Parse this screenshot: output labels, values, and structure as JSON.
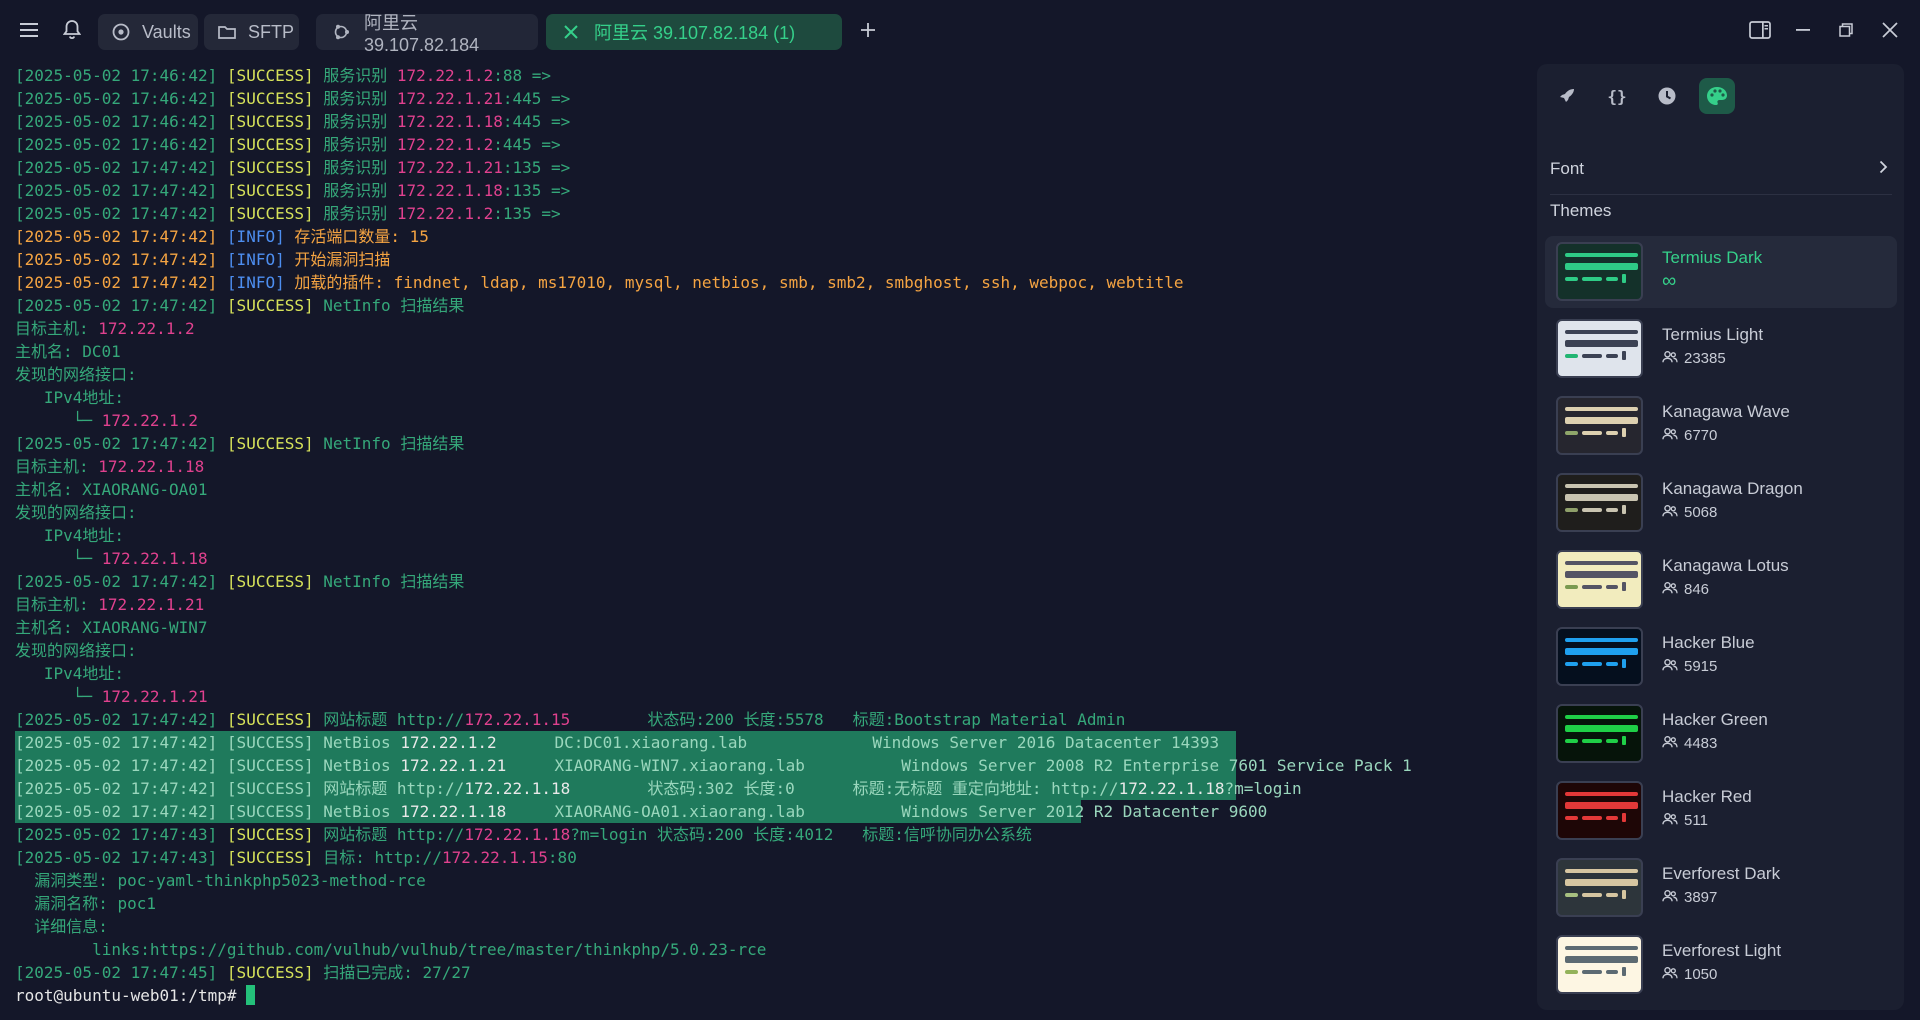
{
  "topbar": {
    "vaults_label": "Vaults",
    "sftp_label": "SFTP",
    "tabs": [
      {
        "label": "阿里云 39.107.82.184",
        "active": false
      },
      {
        "label": "阿里云 39.107.82.184 (1)",
        "active": true
      }
    ]
  },
  "terminal": {
    "lines": [
      {
        "segs": [
          {
            "c": "ts",
            "t": "[2025-05-02 17:46:42] "
          },
          {
            "c": "ok",
            "t": "[SUCCESS] "
          },
          {
            "c": "g",
            "t": "服务识别 "
          },
          {
            "c": "ip",
            "t": "172.22.1.2"
          },
          {
            "c": "g",
            "t": ":88 =>"
          }
        ]
      },
      {
        "segs": [
          {
            "c": "ts",
            "t": "[2025-05-02 17:46:42] "
          },
          {
            "c": "ok",
            "t": "[SUCCESS] "
          },
          {
            "c": "g",
            "t": "服务识别 "
          },
          {
            "c": "ip",
            "t": "172.22.1.21"
          },
          {
            "c": "g",
            "t": ":445 =>"
          }
        ]
      },
      {
        "segs": [
          {
            "c": "ts",
            "t": "[2025-05-02 17:46:42] "
          },
          {
            "c": "ok",
            "t": "[SUCCESS] "
          },
          {
            "c": "g",
            "t": "服务识别 "
          },
          {
            "c": "ip",
            "t": "172.22.1.18"
          },
          {
            "c": "g",
            "t": ":445 =>"
          }
        ]
      },
      {
        "segs": [
          {
            "c": "ts",
            "t": "[2025-05-02 17:46:42] "
          },
          {
            "c": "ok",
            "t": "[SUCCESS] "
          },
          {
            "c": "g",
            "t": "服务识别 "
          },
          {
            "c": "ip",
            "t": "172.22.1.2"
          },
          {
            "c": "g",
            "t": ":445 =>"
          }
        ]
      },
      {
        "segs": [
          {
            "c": "ts",
            "t": "[2025-05-02 17:47:42] "
          },
          {
            "c": "ok",
            "t": "[SUCCESS] "
          },
          {
            "c": "g",
            "t": "服务识别 "
          },
          {
            "c": "ip",
            "t": "172.22.1.21"
          },
          {
            "c": "g",
            "t": ":135 =>"
          }
        ]
      },
      {
        "segs": [
          {
            "c": "ts",
            "t": "[2025-05-02 17:47:42] "
          },
          {
            "c": "ok",
            "t": "[SUCCESS] "
          },
          {
            "c": "g",
            "t": "服务识别 "
          },
          {
            "c": "ip",
            "t": "172.22.1.18"
          },
          {
            "c": "g",
            "t": ":135 =>"
          }
        ]
      },
      {
        "segs": [
          {
            "c": "ts",
            "t": "[2025-05-02 17:47:42] "
          },
          {
            "c": "ok",
            "t": "[SUCCESS] "
          },
          {
            "c": "g",
            "t": "服务识别 "
          },
          {
            "c": "ip",
            "t": "172.22.1.2"
          },
          {
            "c": "g",
            "t": ":135 =>"
          }
        ]
      },
      {
        "segs": [
          {
            "c": "info-ts",
            "t": "[2025-05-02 17:47:42] "
          },
          {
            "c": "info",
            "t": "[INFO] "
          },
          {
            "c": "or",
            "t": "存活端口数量: 15"
          }
        ]
      },
      {
        "segs": [
          {
            "c": "info-ts",
            "t": "[2025-05-02 17:47:42] "
          },
          {
            "c": "info",
            "t": "[INFO] "
          },
          {
            "c": "or",
            "t": "开始漏洞扫描"
          }
        ]
      },
      {
        "segs": [
          {
            "c": "info-ts",
            "t": "[2025-05-02 17:47:42] "
          },
          {
            "c": "info",
            "t": "[INFO] "
          },
          {
            "c": "or",
            "t": "加载的插件: findnet, ldap, ms17010, mysql, netbios, smb, smb2, smbghost, ssh, webpoc, webtitle"
          }
        ]
      },
      {
        "segs": [
          {
            "c": "ts",
            "t": "[2025-05-02 17:47:42] "
          },
          {
            "c": "ok",
            "t": "[SUCCESS] "
          },
          {
            "c": "g",
            "t": "NetInfo 扫描结果"
          }
        ]
      },
      {
        "segs": [
          {
            "c": "g",
            "t": "目标主机: "
          },
          {
            "c": "ip",
            "t": "172.22.1.2"
          }
        ]
      },
      {
        "segs": [
          {
            "c": "g",
            "t": "主机名: DC01"
          }
        ]
      },
      {
        "segs": [
          {
            "c": "g",
            "t": "发现的网络接口:"
          }
        ]
      },
      {
        "segs": [
          {
            "c": "g",
            "t": "   IPv4地址:"
          }
        ]
      },
      {
        "segs": [
          {
            "c": "g",
            "t": "      └─ "
          },
          {
            "c": "ip",
            "t": "172.22.1.2"
          }
        ]
      },
      {
        "segs": [
          {
            "c": "ts",
            "t": "[2025-05-02 17:47:42] "
          },
          {
            "c": "ok",
            "t": "[SUCCESS] "
          },
          {
            "c": "g",
            "t": "NetInfo 扫描结果"
          }
        ]
      },
      {
        "segs": [
          {
            "c": "g",
            "t": "目标主机: "
          },
          {
            "c": "ip",
            "t": "172.22.1.18"
          }
        ]
      },
      {
        "segs": [
          {
            "c": "g",
            "t": "主机名: XIAORANG-OA01"
          }
        ]
      },
      {
        "segs": [
          {
            "c": "g",
            "t": "发现的网络接口:"
          }
        ]
      },
      {
        "segs": [
          {
            "c": "g",
            "t": "   IPv4地址:"
          }
        ]
      },
      {
        "segs": [
          {
            "c": "g",
            "t": "      └─ "
          },
          {
            "c": "ip",
            "t": "172.22.1.18"
          }
        ]
      },
      {
        "segs": [
          {
            "c": "ts",
            "t": "[2025-05-02 17:47:42] "
          },
          {
            "c": "ok",
            "t": "[SUCCESS] "
          },
          {
            "c": "g",
            "t": "NetInfo 扫描结果"
          }
        ]
      },
      {
        "segs": [
          {
            "c": "g",
            "t": "目标主机: "
          },
          {
            "c": "ip",
            "t": "172.22.1.21"
          }
        ]
      },
      {
        "segs": [
          {
            "c": "g",
            "t": "主机名: XIAORANG-WIN7"
          }
        ]
      },
      {
        "segs": [
          {
            "c": "g",
            "t": "发现的网络接口:"
          }
        ]
      },
      {
        "segs": [
          {
            "c": "g",
            "t": "   IPv4地址:"
          }
        ]
      },
      {
        "segs": [
          {
            "c": "g",
            "t": "      └─ "
          },
          {
            "c": "ip",
            "t": "172.22.1.21"
          }
        ]
      },
      {
        "segs": [
          {
            "c": "ts",
            "t": "[2025-05-02 17:47:42] "
          },
          {
            "c": "ok",
            "t": "[SUCCESS] "
          },
          {
            "c": "g",
            "t": "网站标题 http://"
          },
          {
            "c": "ip",
            "t": "172.22.1.15"
          },
          {
            "c": "g",
            "t": "        状态码:200 长度:5578   标题:Bootstrap Material Admin"
          }
        ]
      },
      {
        "hl": true,
        "segs": [
          {
            "c": "hl",
            "t": "[2025-05-02 17:47:42] [SUCCESS] NetBios "
          },
          {
            "c": "hl-ip",
            "t": "172.22.1.2"
          },
          {
            "c": "hl",
            "t": "      DC:DC01.xiaorang.lab             Windows Server 2016 Datacenter 14393"
          }
        ]
      },
      {
        "hl": true,
        "segs": [
          {
            "c": "hl",
            "t": "[2025-05-02 17:47:42] [SUCCESS] NetBios "
          },
          {
            "c": "hl-ip",
            "t": "172.22.1.21"
          },
          {
            "c": "hl",
            "t": "     XIAORANG-WIN7.xiaorang.lab          Windows Server 2008 R2 Enterprise 7601 Service Pack 1"
          }
        ]
      },
      {
        "hl": true,
        "segs": [
          {
            "c": "hl",
            "t": "[2025-05-02 17:47:42] [SUCCESS] 网站标题 http://"
          },
          {
            "c": "hl-ip",
            "t": "172.22.1.18"
          },
          {
            "c": "hl",
            "t": "        状态码:302 长度:0      标题:无标题 重定向地址: http://"
          },
          {
            "c": "hl-ip",
            "t": "172.22.1.18"
          },
          {
            "c": "hl",
            "t": "?m=login"
          }
        ]
      },
      {
        "hl": true,
        "segs": [
          {
            "c": "hl",
            "t": "[2025-05-02 17:47:42] [SUCCESS] NetBios "
          },
          {
            "c": "hl-ip",
            "t": "172.22.1.18"
          },
          {
            "c": "hl",
            "t": "     XIAORANG-OA01.xiaorang.lab          Windows Server 2012 R2 Datacenter 9600 "
          }
        ]
      },
      {
        "segs": [
          {
            "c": "ts",
            "t": "[2025-05-02 17:47:43] "
          },
          {
            "c": "ok",
            "t": "[SUCCESS] "
          },
          {
            "c": "g",
            "t": "网站标题 http://"
          },
          {
            "c": "ip",
            "t": "172.22.1.18"
          },
          {
            "c": "g",
            "t": "?m=login 状态码:200 长度:4012   标题:信呼协同办公系统"
          }
        ]
      },
      {
        "segs": [
          {
            "c": "ts",
            "t": "[2025-05-02 17:47:43] "
          },
          {
            "c": "ok",
            "t": "[SUCCESS] "
          },
          {
            "c": "g",
            "t": "目标: http://"
          },
          {
            "c": "ip",
            "t": "172.22.1.15"
          },
          {
            "c": "g",
            "t": ":80"
          }
        ]
      },
      {
        "segs": [
          {
            "c": "g",
            "t": "  漏洞类型: poc-yaml-thinkphp5023-method-rce"
          }
        ]
      },
      {
        "segs": [
          {
            "c": "g",
            "t": "  漏洞名称: poc1"
          }
        ]
      },
      {
        "segs": [
          {
            "c": "g",
            "t": "  详细信息:"
          }
        ]
      },
      {
        "segs": [
          {
            "c": "g",
            "t": "        links:https://github.com/vulhub/vulhub/tree/master/thinkphp/5.0.23-rce"
          }
        ]
      },
      {
        "segs": [
          {
            "c": "ts",
            "t": "[2025-05-02 17:47:45] "
          },
          {
            "c": "ok",
            "t": "[SUCCESS] "
          },
          {
            "c": "g",
            "t": "扫描已完成: 27/27"
          }
        ]
      },
      {
        "prompt": true,
        "segs": [
          {
            "c": "prompt",
            "t": "root@ubuntu-web01:/tmp# "
          }
        ]
      }
    ]
  },
  "panel": {
    "font_label": "Font",
    "themes_label": "Themes",
    "themes": [
      {
        "name": "Termius Dark",
        "count": "∞",
        "selected": true,
        "bg": "#14312a",
        "c1": "#2ecc86",
        "c2": "#2ecc86",
        "c3": "#2ecc86"
      },
      {
        "name": "Termius Light",
        "count": "23385",
        "selected": false,
        "bg": "#dfe4ec",
        "c1": "#3c4254",
        "c2": "#3c4254",
        "c3": "#22b573"
      },
      {
        "name": "Kanagawa Wave",
        "count": "6770",
        "selected": false,
        "bg": "#26262f",
        "c1": "#ddd0b0",
        "c2": "#ddd0b0",
        "c3": "#8fa66a"
      },
      {
        "name": "Kanagawa Dragon",
        "count": "5068",
        "selected": false,
        "bg": "#1f1e1c",
        "c1": "#c9c4b0",
        "c2": "#c9c4b0",
        "c3": "#8fa06a"
      },
      {
        "name": "Kanagawa Lotus",
        "count": "846",
        "selected": false,
        "bg": "#f2ecbe",
        "c1": "#545464",
        "c2": "#545464",
        "c3": "#7a9a50"
      },
      {
        "name": "Hacker Blue",
        "count": "5915",
        "selected": false,
        "bg": "#050f1e",
        "c1": "#1fa0ef",
        "c2": "#1fa0ef",
        "c3": "#1fa0ef"
      },
      {
        "name": "Hacker Green",
        "count": "4483",
        "selected": false,
        "bg": "#06140a",
        "c1": "#1fd047",
        "c2": "#1fd047",
        "c3": "#1fd047"
      },
      {
        "name": "Hacker Red",
        "count": "511",
        "selected": false,
        "bg": "#1e0606",
        "c1": "#e33838",
        "c2": "#e33838",
        "c3": "#e33838"
      },
      {
        "name": "Everforest Dark",
        "count": "3897",
        "selected": false,
        "bg": "#2d353b",
        "c1": "#d6c6a1",
        "c2": "#d6c6a1",
        "c3": "#a7c080"
      },
      {
        "name": "Everforest Light",
        "count": "1050",
        "selected": false,
        "bg": "#fdf6e3",
        "c1": "#5c6a72",
        "c2": "#5c6a72",
        "c3": "#93b259"
      }
    ]
  },
  "icons": {
    "menu": "hamburger-menu-icon",
    "bell": "bell-icon",
    "vaults": "vault-icon",
    "sftp": "folder-icon",
    "tab_inactive": "ubuntu-icon",
    "tab_active": "close-icon",
    "add_tab": "plus-icon",
    "sidebar_toggle": "sidebar-toggle-icon",
    "minimize": "minimize-icon",
    "restore": "restore-icon",
    "close": "close-window-icon",
    "panel_tools": [
      "rocket-icon",
      "braces-icon",
      "history-icon",
      "palette-icon"
    ]
  }
}
